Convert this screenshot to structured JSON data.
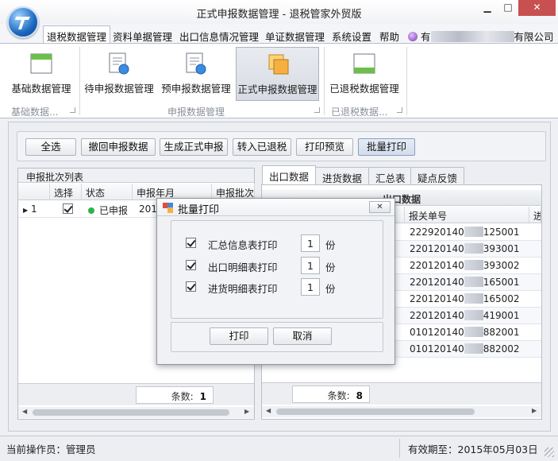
{
  "window": {
    "title": "正式申报数据管理 - 退税管家外贸版",
    "min_glyph": "▁",
    "max_glyph": "□",
    "close_glyph": "✕"
  },
  "menu": {
    "items": [
      "退税数据管理",
      "资料单据管理",
      "出口信息情况管理",
      "单证数据管理",
      "系统设置",
      "帮助"
    ],
    "company_prefix": "有",
    "company_suffix": "有限公司"
  },
  "ribbon": {
    "buttons": [
      "基础数据管理",
      "待申报数据管理",
      "预申报数据管理",
      "正式申报数据管理",
      "已退税数据管理"
    ],
    "groups": [
      "基础数据...",
      "申报数据管理",
      "已退税数据..."
    ]
  },
  "toolbar": {
    "buttons": [
      "全选",
      "撤回申报数据",
      "生成正式申报",
      "转入已退税",
      "打印预览",
      "批量打印"
    ]
  },
  "batch_panel": {
    "title": "申报批次列表",
    "columns": [
      "选择",
      "状态",
      "申报年月",
      "申报批次"
    ],
    "rows": [
      {
        "index": "1",
        "checked": true,
        "status": "已申报",
        "month": "2014"
      }
    ],
    "count_label": "条数:",
    "count": "1"
  },
  "tabs": [
    "出口数据",
    "进货数据",
    "汇总表",
    "疑点反馈"
  ],
  "export_panel": {
    "caption": "出口数据",
    "columns": [
      "报关单号",
      "进"
    ],
    "rows": [
      {
        "prefix": "222920140",
        "suffix": "125001"
      },
      {
        "prefix": "220120140",
        "suffix": "393001"
      },
      {
        "prefix": "220120140",
        "suffix": "393002"
      },
      {
        "prefix": "220120140",
        "suffix": "165001"
      },
      {
        "prefix": "220120140",
        "suffix": "165002"
      },
      {
        "prefix": "220120140",
        "suffix": "419001"
      },
      {
        "prefix": "010120140",
        "suffix": "882001"
      },
      {
        "prefix": "010120140",
        "suffix": "882002"
      }
    ],
    "count_label": "条数:",
    "count": "8"
  },
  "dialog": {
    "title": "批量打印",
    "close_glyph": "✕",
    "options": [
      {
        "label": "汇总信息表打印",
        "checked": true,
        "copies": "1",
        "unit": "份"
      },
      {
        "label": "出口明细表打印",
        "checked": true,
        "copies": "1",
        "unit": "份"
      },
      {
        "label": "进货明细表打印",
        "checked": true,
        "copies": "1",
        "unit": "份"
      }
    ],
    "print_label": "打印",
    "cancel_label": "取消"
  },
  "statusbar": {
    "operator": "当前操作员：管理员",
    "expiry": "有效期至：2015年05月03日"
  },
  "colors": {
    "accent": "#1c69c0",
    "status_ok": "#2bb34a",
    "close_red": "#c75050"
  }
}
